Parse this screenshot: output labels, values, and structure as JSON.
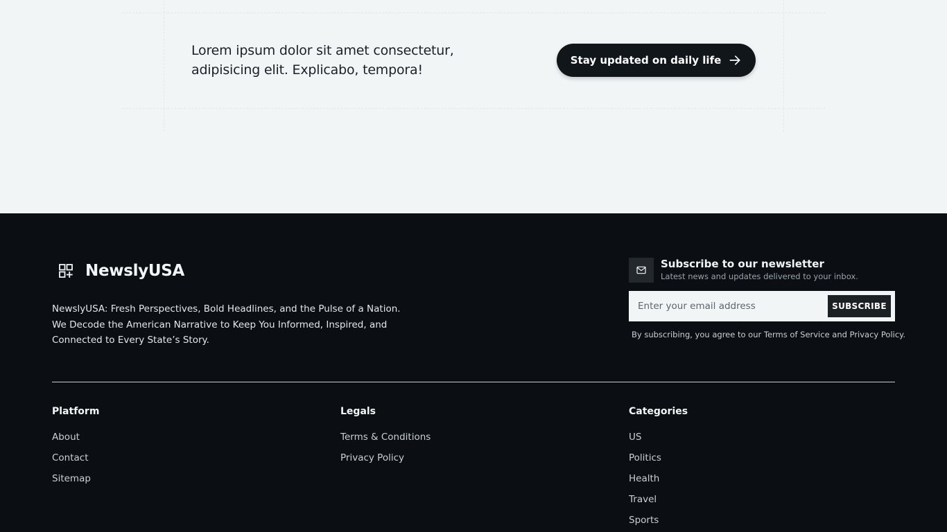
{
  "cta": {
    "text": "Lorem ipsum dolor sit amet consectetur, adipisicing elit. Explicabo, tempora!",
    "button_label": "Stay updated on daily life",
    "button_icon": "arrow-right-icon"
  },
  "footer": {
    "brand": {
      "logo_icon": "layout-plus-icon",
      "name": "NewslyUSA",
      "description": "NewslyUSA: Fresh Perspectives, Bold Headlines, and the Pulse of a Nation. We Decode the American Narrative to Keep You Informed, Inspired, and Connected to Every State’s Story."
    },
    "newsletter": {
      "icon": "mail-icon",
      "title": "Subscribe to our newsletter",
      "subtitle": "Latest news and updates delivered to your inbox.",
      "email_placeholder": "Enter your email address",
      "email_value": "",
      "button_label": "SUBSCRIBE",
      "terms": "By subscribing, you agree to our Terms of Service and Privacy Policy."
    },
    "columns": [
      {
        "title": "Platform",
        "links": [
          "About",
          "Contact",
          "Sitemap"
        ]
      },
      {
        "title": "Legals",
        "links": [
          "Terms & Conditions",
          "Privacy Policy"
        ]
      },
      {
        "title": "Categories",
        "links": [
          "US",
          "Politics",
          "Health",
          "Travel",
          "Sports"
        ]
      }
    ]
  },
  "colors": {
    "footer_bg": "#0b0f13",
    "band_bg": "#f1f5f6",
    "button_dark": "#11161b"
  }
}
